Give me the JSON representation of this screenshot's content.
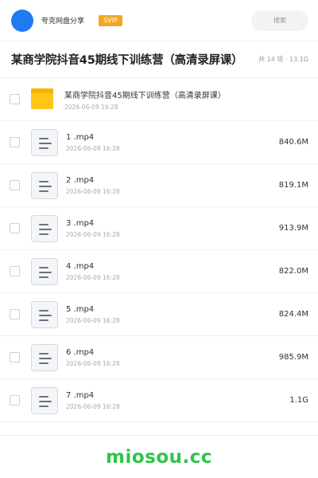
{
  "header": {
    "user_name": "夸克网盘分享",
    "badge": "SVIP",
    "search_label": "搜索"
  },
  "share": {
    "title": "某商学院抖音45期线下训练营（高清录屏课）",
    "meta": "共 14 项 · 13.1G"
  },
  "files": [
    {
      "type": "folder",
      "name": "某商学院抖音45期线下训练营（高清录屏课）",
      "date": "2026-06-09 16:28",
      "size": ""
    },
    {
      "type": "file",
      "name": "1 .mp4",
      "date": "2026-06-09 16:28",
      "size": "840.6M"
    },
    {
      "type": "file",
      "name": "2 .mp4",
      "date": "2026-06-09 16:28",
      "size": "819.1M"
    },
    {
      "type": "file",
      "name": "3 .mp4",
      "date": "2026-06-09 16:28",
      "size": "913.9M"
    },
    {
      "type": "file",
      "name": "4 .mp4",
      "date": "2026-06-09 16:28",
      "size": "822.0M"
    },
    {
      "type": "file",
      "name": "5 .mp4",
      "date": "2026-06-09 16:28",
      "size": "824.4M"
    },
    {
      "type": "file",
      "name": "6 .mp4",
      "date": "2026-06-09 16:28",
      "size": "985.9M"
    },
    {
      "type": "file",
      "name": "7 .mp4",
      "date": "2026-06-09 16:28",
      "size": "1.1G"
    }
  ],
  "footer": {
    "watermark": "miosou.cc"
  },
  "colors": {
    "avatar": "#1e7bf0",
    "badge": "#f5a623",
    "folder": "#ffc61a",
    "watermark": "#2ec44a"
  }
}
